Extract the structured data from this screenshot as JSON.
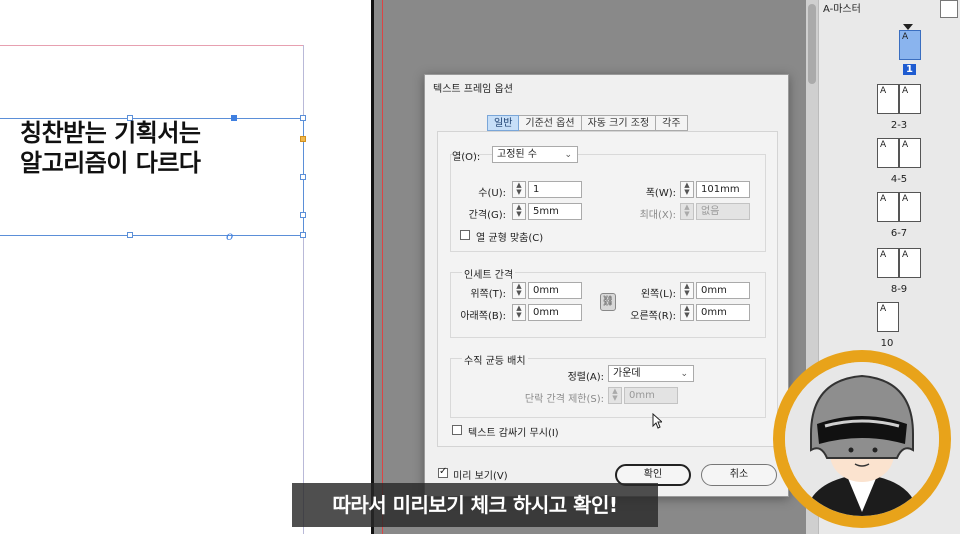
{
  "document": {
    "heading_line1": "칭찬받는 기획서는",
    "heading_line2": "알고리즘이 다르다",
    "link_mark": "o"
  },
  "pages_panel": {
    "master_label": "A-마스터",
    "selected_page_label": "1",
    "page_letter": "A",
    "spread_labels": [
      "2-3",
      "4-5",
      "6-7",
      "8-9",
      "10"
    ]
  },
  "dialog": {
    "title": "텍스트 프레임 옵션",
    "tabs": [
      {
        "label": "일반",
        "active": true
      },
      {
        "label": "기준선 옵션",
        "active": false
      },
      {
        "label": "자동 크기 조정",
        "active": false
      },
      {
        "label": "각주",
        "active": false
      }
    ],
    "columns": {
      "label": "열(O):",
      "type_value": "고정된 수",
      "count_label": "수(U):",
      "count_value": "1",
      "width_label": "폭(W):",
      "width_value": "101mm",
      "gutter_label": "간격(G):",
      "gutter_value": "5mm",
      "max_label": "최대(X):",
      "max_value": "없음",
      "balance_label": "열 균형 맞춤(C)"
    },
    "inset": {
      "title": "인세트 간격",
      "top_label": "위쪽(T):",
      "top_value": "0mm",
      "bottom_label": "아래쪽(B):",
      "bottom_value": "0mm",
      "left_label": "왼쪽(L):",
      "left_value": "0mm",
      "right_label": "오른쪽(R):",
      "right_value": "0mm"
    },
    "vertical": {
      "title": "수직 균등 배치",
      "align_label": "정렬(A):",
      "align_value": "가운데",
      "para_label": "단락 간격 제한(S):",
      "para_value": "0mm"
    },
    "ignore_wrap_label": "텍스트 감싸기 무시(I)",
    "preview_label": "미리 보기(V)",
    "ok_label": "확인",
    "cancel_label": "취소"
  },
  "subtitle": "따라서 미리보기 체크 하시고 확인!"
}
